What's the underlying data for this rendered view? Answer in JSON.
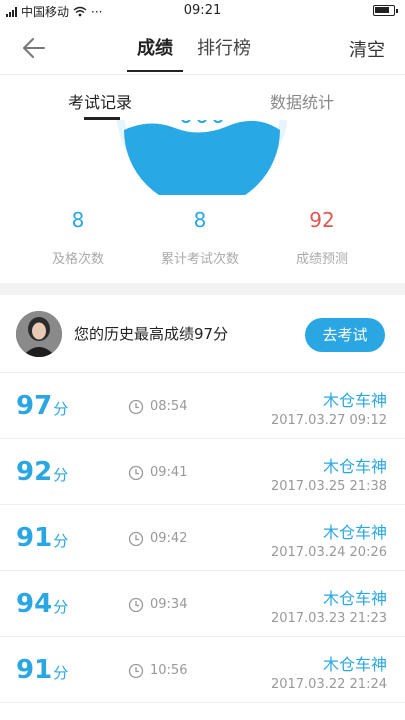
{
  "status": {
    "carrier": "中国移动",
    "dots": "···",
    "time": "09:21"
  },
  "nav": {
    "tabs": [
      "成绩",
      "排行榜"
    ],
    "clear_label": "清空"
  },
  "subtabs": [
    "考试记录",
    "数据统计"
  ],
  "stats": [
    {
      "value": "8",
      "label": "及格次数"
    },
    {
      "value": "8",
      "label": "累计考试次数"
    },
    {
      "value": "92",
      "label": "成绩预测"
    }
  ],
  "best": {
    "text": "您的历史最高成绩97分",
    "button": "去考试"
  },
  "records": [
    {
      "score": "97",
      "unit": "分",
      "duration": "08:54",
      "name": "木仓车神",
      "date": "2017.03.27  09:12"
    },
    {
      "score": "92",
      "unit": "分",
      "duration": "09:41",
      "name": "木仓车神",
      "date": "2017.03.25  21:38"
    },
    {
      "score": "91",
      "unit": "分",
      "duration": "09:42",
      "name": "木仓车神",
      "date": "2017.03.24  20:26"
    },
    {
      "score": "94",
      "unit": "分",
      "duration": "09:34",
      "name": "木仓车神",
      "date": "2017.03.23  21:23"
    },
    {
      "score": "91",
      "unit": "分",
      "duration": "10:56",
      "name": "木仓车神",
      "date": "2017.03.22  21:24"
    }
  ],
  "colors": {
    "accent": "#2aa7e3",
    "prediction": "#e0584f"
  },
  "icons": [
    "back-arrow-icon",
    "clock-icon",
    "wifi-icon",
    "battery-icon"
  ]
}
